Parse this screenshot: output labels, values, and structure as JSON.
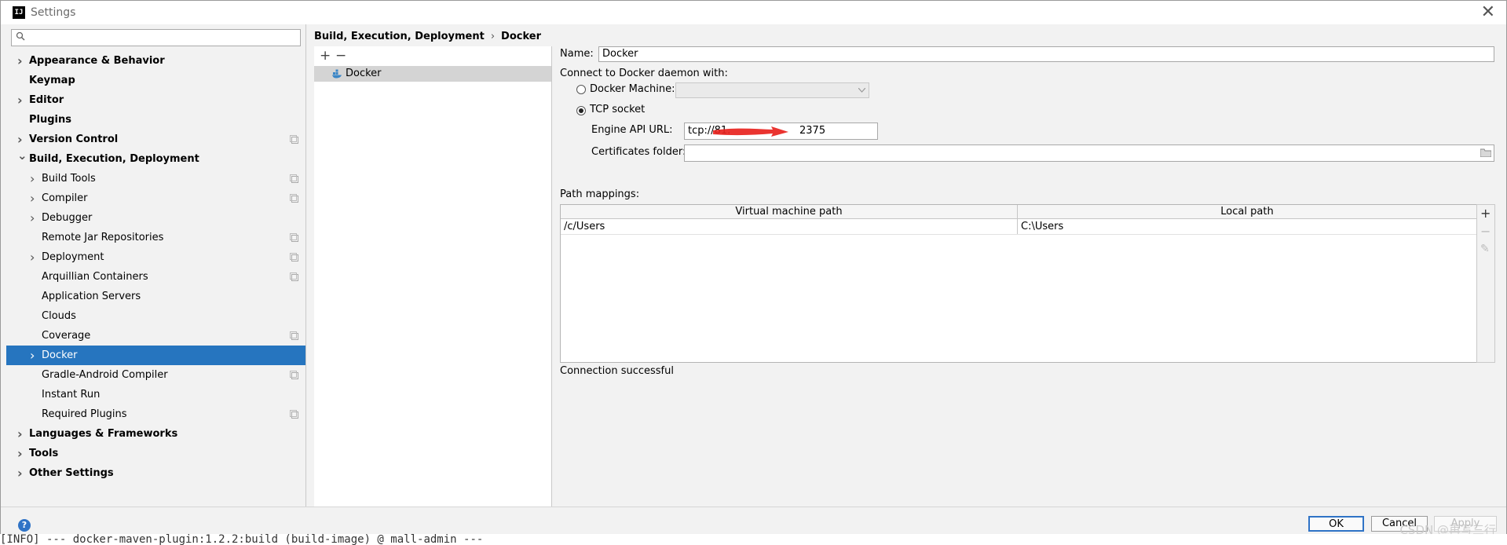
{
  "window": {
    "title": "Settings",
    "app_icon": "IJ",
    "close_glyph": "✕"
  },
  "sidebar": {
    "search_placeholder": "",
    "items": [
      {
        "label": "Appearance & Behavior",
        "bold": true,
        "chevron": "right",
        "indent": 0,
        "copy": false
      },
      {
        "label": "Keymap",
        "bold": true,
        "chevron": "none",
        "indent": 0,
        "copy": false
      },
      {
        "label": "Editor",
        "bold": true,
        "chevron": "right",
        "indent": 0,
        "copy": false
      },
      {
        "label": "Plugins",
        "bold": true,
        "chevron": "none",
        "indent": 0,
        "copy": false
      },
      {
        "label": "Version Control",
        "bold": true,
        "chevron": "right",
        "indent": 0,
        "copy": true
      },
      {
        "label": "Build, Execution, Deployment",
        "bold": true,
        "chevron": "down",
        "indent": 0,
        "copy": false
      },
      {
        "label": "Build Tools",
        "bold": false,
        "chevron": "right",
        "indent": 1,
        "copy": true
      },
      {
        "label": "Compiler",
        "bold": false,
        "chevron": "right",
        "indent": 1,
        "copy": true
      },
      {
        "label": "Debugger",
        "bold": false,
        "chevron": "right",
        "indent": 1,
        "copy": false
      },
      {
        "label": "Remote Jar Repositories",
        "bold": false,
        "chevron": "none",
        "indent": 1,
        "copy": true
      },
      {
        "label": "Deployment",
        "bold": false,
        "chevron": "right",
        "indent": 1,
        "copy": true
      },
      {
        "label": "Arquillian Containers",
        "bold": false,
        "chevron": "none",
        "indent": 1,
        "copy": true
      },
      {
        "label": "Application Servers",
        "bold": false,
        "chevron": "none",
        "indent": 1,
        "copy": false
      },
      {
        "label": "Clouds",
        "bold": false,
        "chevron": "none",
        "indent": 1,
        "copy": false
      },
      {
        "label": "Coverage",
        "bold": false,
        "chevron": "none",
        "indent": 1,
        "copy": true
      },
      {
        "label": "Docker",
        "bold": false,
        "chevron": "right",
        "indent": 1,
        "copy": false,
        "selected": true
      },
      {
        "label": "Gradle-Android Compiler",
        "bold": false,
        "chevron": "none",
        "indent": 1,
        "copy": true
      },
      {
        "label": "Instant Run",
        "bold": false,
        "chevron": "none",
        "indent": 1,
        "copy": false
      },
      {
        "label": "Required Plugins",
        "bold": false,
        "chevron": "none",
        "indent": 1,
        "copy": true
      },
      {
        "label": "Languages & Frameworks",
        "bold": true,
        "chevron": "right",
        "indent": 0,
        "copy": false
      },
      {
        "label": "Tools",
        "bold": true,
        "chevron": "right",
        "indent": 0,
        "copy": false
      },
      {
        "label": "Other Settings",
        "bold": true,
        "chevron": "right",
        "indent": 0,
        "copy": false
      }
    ]
  },
  "breadcrumb": {
    "parent": "Build, Execution, Deployment",
    "separator": "›",
    "current": "Docker"
  },
  "list_panel": {
    "add_glyph": "+",
    "remove_glyph": "−",
    "items": [
      "Docker"
    ]
  },
  "form": {
    "name_label": "Name:",
    "name_value": "Docker",
    "connect_label": "Connect to Docker daemon with:",
    "docker_machine_label": "Docker Machine:",
    "docker_machine_value": "",
    "tcp_label": "TCP socket",
    "engine_label": "Engine API URL:",
    "engine_value": "tcp://81.",
    "engine_value_tail": "2375",
    "certs_label": "Certificates folder:",
    "certs_value": "",
    "path_mappings_label": "Path mappings:",
    "selected_connection": "tcp"
  },
  "path_table": {
    "columns": [
      "Virtual machine path",
      "Local path"
    ],
    "rows": [
      [
        "/c/Users",
        "C:\\Users"
      ]
    ]
  },
  "table_tools": {
    "add": "+",
    "remove": "−",
    "edit": "✎"
  },
  "status": "Connection successful",
  "buttons": {
    "ok": "OK",
    "cancel": "Cancel",
    "apply": "Apply"
  },
  "help_glyph": "?",
  "watermark": "CSDN @再写三行",
  "console_text": "[INFO] --- docker-maven-plugin:1.2.2:build (build-image) @ mall-admin ---",
  "colors": {
    "selection": "#2675bf",
    "annotation": "#e8231e"
  }
}
